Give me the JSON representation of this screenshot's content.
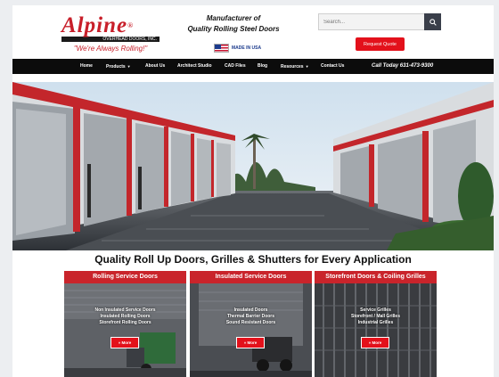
{
  "header": {
    "logo_word": "Alpine",
    "logo_sub": "OVERHEAD DOORS, INC.",
    "logo_tagline": "\"We're Always Rolling!\"",
    "maker_line1": "Manufacturer of",
    "maker_line2": "Quality Rolling Steel Doors",
    "made_in_usa": "MADE IN USA",
    "search_placeholder": "Search...",
    "quote_button": "Request Quote"
  },
  "nav": {
    "items": [
      {
        "label": "Home"
      },
      {
        "label": "Products"
      },
      {
        "label": "About Us"
      },
      {
        "label": "Architect Studio"
      },
      {
        "label": "CAD Files"
      },
      {
        "label": "Blog"
      },
      {
        "label": "Resources"
      },
      {
        "label": "Contact Us"
      }
    ],
    "call": "Call Today 631-473-9300"
  },
  "headline": "Quality Roll Up Doors, Grilles & Shutters for Every Application",
  "cards": [
    {
      "title": "Rolling Service Doors",
      "lines": [
        "Non Insulated Service Doors",
        "Insulated Rolling Doors",
        "Storefront Rolling Doors"
      ],
      "button": "» More"
    },
    {
      "title": "Insulated Service Doors",
      "lines": [
        "Insulated Doors",
        "Thermal Barrier Doors",
        "Sound Resistant Doors"
      ],
      "button": "» More"
    },
    {
      "title": "Storefront Doors & Coiling Grilles",
      "lines": [
        "Service Grilles",
        "Storefront / Mall Grilles",
        "Industrial Grilles"
      ],
      "button": "» More"
    }
  ],
  "colors": {
    "brand_red": "#c81f2a",
    "button_red": "#e3111b",
    "nav_black": "#0c0c0c"
  }
}
